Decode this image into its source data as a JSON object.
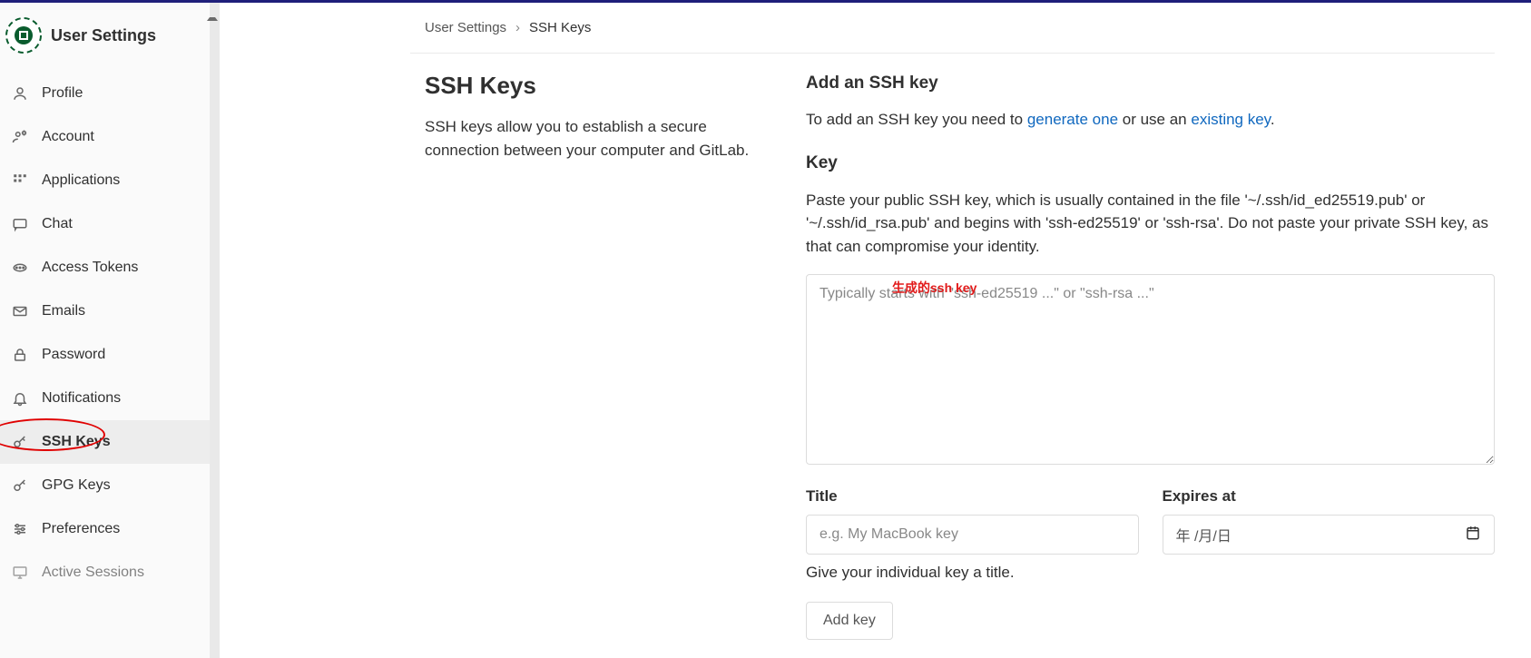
{
  "sidebar": {
    "title": "User Settings",
    "items": [
      {
        "icon": "profile",
        "label": "Profile"
      },
      {
        "icon": "account",
        "label": "Account"
      },
      {
        "icon": "apps",
        "label": "Applications"
      },
      {
        "icon": "chat",
        "label": "Chat"
      },
      {
        "icon": "token",
        "label": "Access Tokens"
      },
      {
        "icon": "emails",
        "label": "Emails"
      },
      {
        "icon": "password",
        "label": "Password"
      },
      {
        "icon": "notifications",
        "label": "Notifications"
      },
      {
        "icon": "ssh",
        "label": "SSH Keys",
        "active": true
      },
      {
        "icon": "gpg",
        "label": "GPG Keys"
      },
      {
        "icon": "prefs",
        "label": "Preferences"
      },
      {
        "icon": "sessions",
        "label": "Active Sessions"
      }
    ]
  },
  "breadcrumb": {
    "root": "User Settings",
    "sep": "›",
    "current": "SSH Keys"
  },
  "left": {
    "title": "SSH Keys",
    "desc": "SSH keys allow you to establish a secure connection between your computer and GitLab."
  },
  "right": {
    "add_title": "Add an SSH key",
    "add_text_prefix": "To add an SSH key you need to ",
    "link_generate": "generate one",
    "add_text_mid": " or use an ",
    "link_existing": "existing key",
    "add_text_suffix": ".",
    "key_label": "Key",
    "key_help": "Paste your public SSH key, which is usually contained in the file '~/.ssh/id_ed25519.pub' or '~/.ssh/id_rsa.pub' and begins with 'ssh-ed25519' or 'ssh-rsa'. Do not paste your private SSH key, as that can compromise your identity.",
    "key_placeholder": "Typically starts with \"ssh-ed25519 ...\" or \"ssh-rsa ...\"",
    "overlay": "生成的ssh key",
    "title_label": "Title",
    "title_placeholder": "e.g. My MacBook key",
    "title_hint": "Give your individual key a title.",
    "expires_label": "Expires at",
    "expires_placeholder": "年 /月/日",
    "add_button": "Add key"
  }
}
